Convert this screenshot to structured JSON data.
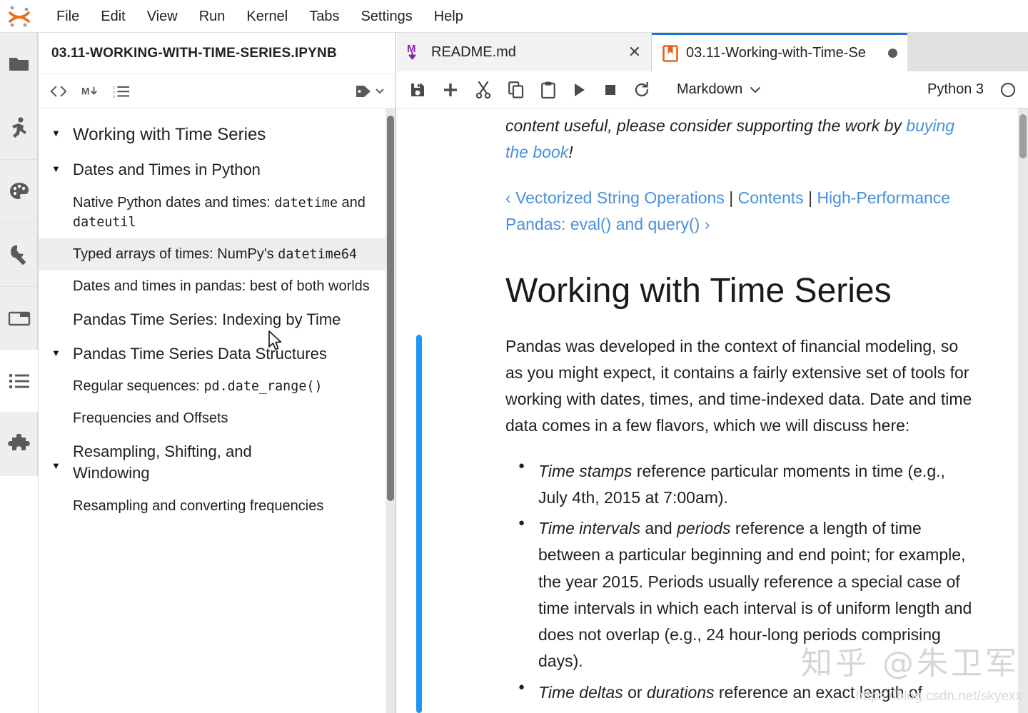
{
  "menubar": {
    "logo": "jupyter-logo",
    "items": [
      {
        "label": "File"
      },
      {
        "label": "Edit"
      },
      {
        "label": "View"
      },
      {
        "label": "Run"
      },
      {
        "label": "Kernel"
      },
      {
        "label": "Tabs"
      },
      {
        "label": "Settings"
      },
      {
        "label": "Help"
      }
    ]
  },
  "rail": {
    "items": [
      {
        "name": "file-browser-icon",
        "title": "File Browser"
      },
      {
        "name": "running-terminals-icon",
        "title": "Running Terminals and Kernels"
      },
      {
        "name": "palette-icon",
        "title": "Commands"
      },
      {
        "name": "wrench-icon",
        "title": "Property Inspector"
      },
      {
        "name": "open-tabs-icon",
        "title": "Open Tabs"
      },
      {
        "name": "table-of-contents-icon",
        "title": "Table of Contents"
      },
      {
        "name": "extension-manager-icon",
        "title": "Extension Manager"
      }
    ]
  },
  "toc": {
    "header": "03.11-WORKING-WITH-TIME-SERIES.IPYNB",
    "toolbar": [
      {
        "name": "show-code-icon",
        "label": "<>"
      },
      {
        "name": "show-markdown-icon",
        "label": "M"
      },
      {
        "name": "numbering-icon",
        "label": "list"
      },
      {
        "name": "tag-icon",
        "label": "tag"
      }
    ],
    "items": [
      {
        "level": 1,
        "caret": "▼",
        "text": "Working with Time Series",
        "active": false
      },
      {
        "level": 2,
        "caret": "▼",
        "text": "Dates and Times in Python",
        "active": false
      },
      {
        "level": 3,
        "caret": "",
        "text": "Native Python dates and times: ",
        "code": "datetime",
        "text2": " and ",
        "code2": "dateutil",
        "active": false
      },
      {
        "level": 3,
        "caret": "",
        "text": "Typed arrays of times: NumPy's ",
        "code": "datetime64",
        "active": true
      },
      {
        "level": 3,
        "caret": "",
        "text": "Dates and times in pandas: best of both worlds",
        "active": false
      },
      {
        "level": 2,
        "caret": "",
        "text": "Pandas Time Series: Indexing by Time",
        "active": false
      },
      {
        "level": 2,
        "caret": "▼",
        "text": "Pandas Time Series Data Structures",
        "active": false
      },
      {
        "level": 3,
        "caret": "",
        "text": "Regular sequences: ",
        "code": "pd.date_range()",
        "active": false
      },
      {
        "level": 3,
        "caret": "",
        "text": "Frequencies and Offsets",
        "active": false
      },
      {
        "level": 2,
        "caret": "▼",
        "text": "Resampling, Shifting, and Windowing",
        "active": false
      },
      {
        "level": 3,
        "caret": "",
        "text": "Resampling and converting frequencies",
        "active": false
      }
    ]
  },
  "tabs": [
    {
      "name": "tab-readme",
      "title": "README.md",
      "icon": "markdown-icon",
      "active": false,
      "close": "✕"
    },
    {
      "name": "tab-notebook",
      "title": "03.11-Working-with-Time-Se",
      "icon": "notebook-icon",
      "active": true,
      "dirty": true
    }
  ],
  "notebook_toolbar": {
    "buttons": [
      {
        "name": "save-button",
        "title": "Save"
      },
      {
        "name": "insert-cell-button",
        "title": "Insert a cell below"
      },
      {
        "name": "cut-button",
        "title": "Cut cells"
      },
      {
        "name": "copy-button",
        "title": "Copy cells"
      },
      {
        "name": "paste-button",
        "title": "Paste cells"
      },
      {
        "name": "run-button",
        "title": "Run cells"
      },
      {
        "name": "stop-button",
        "title": "Interrupt kernel"
      },
      {
        "name": "restart-button",
        "title": "Restart kernel"
      }
    ],
    "cell_type": "Markdown",
    "kernel_name": "Python 3",
    "kernel_status": "idle"
  },
  "notebook_content": {
    "intro_prefix": "content useful, please consider supporting the work by ",
    "intro_link": "buying the book",
    "intro_suffix": "!",
    "nav": {
      "prev_arrow": "‹",
      "prev": "Vectorized String Operations",
      "sep1": "|",
      "contents": "Contents",
      "sep2": "|",
      "next": "High-Performance Pandas: eval() and query()",
      "next_arrow": "›"
    },
    "heading": "Working with Time Series",
    "paragraph": "Pandas was developed in the context of financial modeling, so as you might expect, it contains a fairly extensive set of tools for working with dates, times, and time-indexed data. Date and time data comes in a few flavors, which we will discuss here:",
    "bullets": [
      {
        "em1": "Time stamps",
        "rest1": " reference particular moments in time (e.g., July 4th, 2015 at 7:00am)."
      },
      {
        "em1": "Time intervals",
        "mid": " and ",
        "em2": "periods",
        "rest1": " reference a length of time between a particular beginning and end point; for example, the year 2015. Periods usually reference a special case of time intervals in which each interval is of uniform length and does not overlap (e.g., 24 hour-long periods comprising days)."
      },
      {
        "em1": "Time deltas",
        "mid": " or ",
        "em2": "durations",
        "rest1": " reference an exact length of"
      }
    ]
  },
  "watermark": {
    "text": "知乎 @朱卫军",
    "url": "https://blog.csdn.net/skyexx"
  },
  "colors": {
    "accent_blue": "#2196f3",
    "link_blue": "#4a90d9",
    "tab_active_border": "#1976d2",
    "markdown_icon": "#8e24aa",
    "notebook_icon": "#e8641a"
  }
}
